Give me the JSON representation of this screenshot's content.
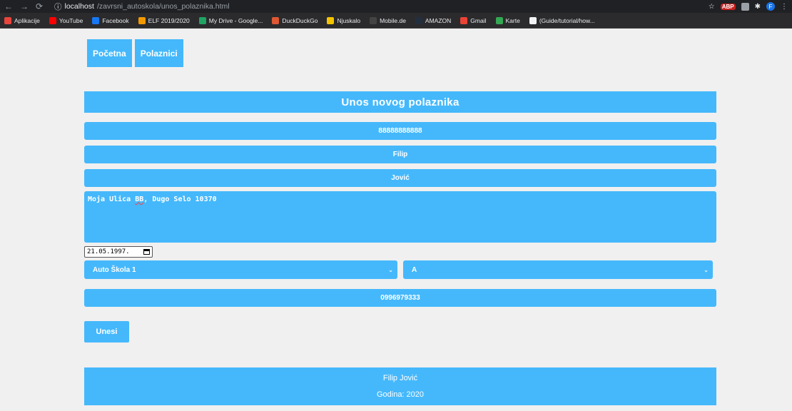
{
  "browser": {
    "url_host": "localhost",
    "url_path": "/zavrsni_autoskola/unos_polaznika.html",
    "bookmarks": [
      {
        "label": "Aplikacije",
        "icon": "apps-icon",
        "color": "#e8453c"
      },
      {
        "label": "YouTube",
        "icon": "youtube-icon",
        "color": "#ff0000"
      },
      {
        "label": "Facebook",
        "icon": "facebook-icon",
        "color": "#1877f2"
      },
      {
        "label": "ELF 2019/2020",
        "icon": "elf-icon",
        "color": "#f29900"
      },
      {
        "label": "My Drive - Google...",
        "icon": "drive-icon",
        "color": "#1fa463"
      },
      {
        "label": "DuckDuckGo",
        "icon": "duckduckgo-icon",
        "color": "#de5833"
      },
      {
        "label": "Njuskalo",
        "icon": "njuskalo-icon",
        "color": "#f5c400"
      },
      {
        "label": "Mobile.de",
        "icon": "mobilede-icon",
        "color": "#444444"
      },
      {
        "label": "AMAZON",
        "icon": "amazon-icon",
        "color": "#232f3e"
      },
      {
        "label": "Gmail",
        "icon": "gmail-icon",
        "color": "#ea4335"
      },
      {
        "label": "Karte",
        "icon": "maps-icon",
        "color": "#34a853"
      },
      {
        "label": "(Guide/tutorial/how...",
        "icon": "page-icon",
        "color": "#f1f3f4"
      }
    ]
  },
  "nav": {
    "home": "Početna",
    "students": "Polaznici"
  },
  "form": {
    "title": "Unos novog polaznika",
    "oib": "88888888888",
    "first_name": "Filip",
    "last_name": "Jović",
    "address": "Moja Ulica BB, Dugo Selo 10370",
    "birth_date": "21.05.1997.",
    "school": "Auto Škola 1",
    "category": "A",
    "phone": "0996979333",
    "submit": "Unesi"
  },
  "footer": {
    "author": "Filip Jović",
    "year": "Godina: 2020"
  },
  "colors": {
    "accent": "#45b8fb",
    "page_bg": "#f0f0f0"
  }
}
